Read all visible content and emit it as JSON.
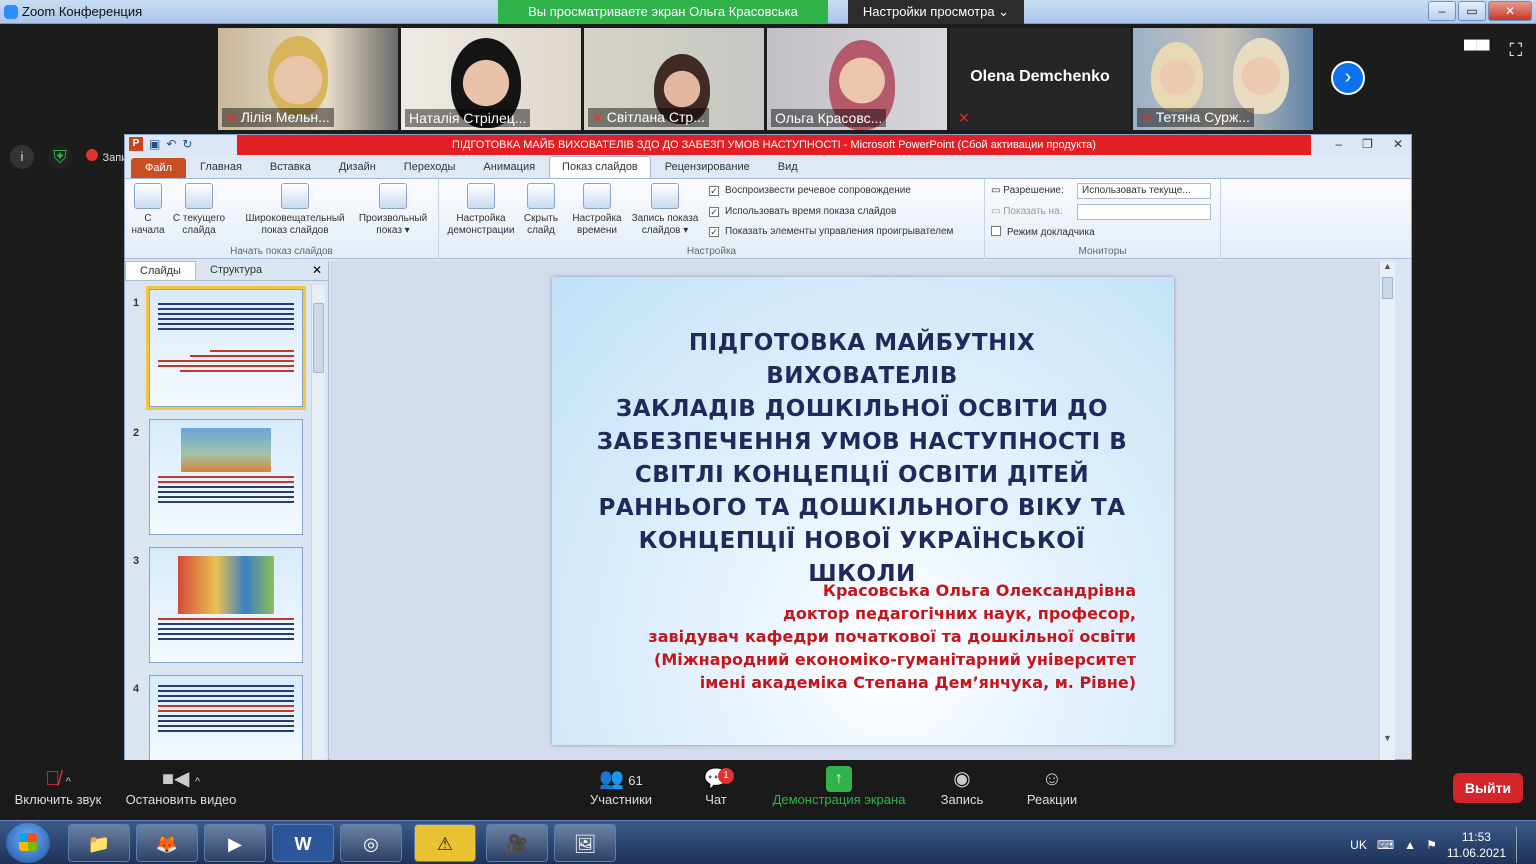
{
  "zoom": {
    "window_title": "Zoom Конференция",
    "share_banner": "Вы просматриваете экран Ольга Красовська",
    "view_options": "Настройки просмотра ⌄",
    "recording_label": "Запись",
    "participants": [
      {
        "name": "Лілія Мельн...",
        "muted": true
      },
      {
        "name": "Наталія Стрілец...",
        "muted": false
      },
      {
        "name": "Світлана Стр...",
        "muted": true
      },
      {
        "name": "Ольга Красовс...",
        "muted": false
      },
      {
        "name": "Olena Demchenko",
        "muted": true,
        "video_off": true
      },
      {
        "name": "Тетяна Сурж...",
        "muted": true
      }
    ],
    "toolbar": {
      "unmute": "Включить звук",
      "stop_video": "Остановить видео",
      "participants": "Участники",
      "participants_count": "61",
      "chat": "Чат",
      "chat_badge": "1",
      "share_screen": "Демонстрация экрана",
      "record": "Запись",
      "reactions": "Реакции",
      "leave": "Выйти"
    }
  },
  "ppt": {
    "title": "ПІДГОТОВКА МАЙБ ВИХОВАТЕЛІВ ЗДО ДО ЗАБЕЗП УМОВ НАСТУПНОСТІ  -  Microsoft PowerPoint (Сбой активации продукта)",
    "tabs": [
      "Файл",
      "Главная",
      "Вставка",
      "Дизайн",
      "Переходы",
      "Анимация",
      "Показ слайдов",
      "Рецензирование",
      "Вид"
    ],
    "ribbon": {
      "start_group": {
        "label": "Начать показ слайдов",
        "buttons": [
          "С начала",
          "С текущего слайда",
          "Широковещательный показ слайдов",
          "Произвольный показ ▾"
        ]
      },
      "setup_group": {
        "label": "Настройка",
        "buttons": [
          "Настройка демонстрации",
          "Скрыть слайд",
          "Настройка времени",
          "Запись показа слайдов ▾"
        ],
        "checks": [
          "Воспроизвести речевое сопровождение",
          "Использовать время показа слайдов",
          "Показать элементы управления проигрывателем"
        ]
      },
      "monitors_group": {
        "label": "Мониторы",
        "resolution_label": "Разрешение:",
        "resolution_value": "Использовать текуще...",
        "show_on_label": "Показать на:",
        "presenter_view": "Режим докладчика"
      }
    },
    "panel_tabs": [
      "Слайды",
      "Структура"
    ],
    "thumb_numbers": [
      "1",
      "2",
      "3",
      "4"
    ],
    "slide": {
      "title_lines": [
        "ПІДГОТОВКА МАЙБУТНІХ ВИХОВАТЕЛІВ",
        "ЗАКЛАДІВ ДОШКІЛЬНОЇ ОСВІТИ ДО",
        "ЗАБЕЗПЕЧЕННЯ УМОВ НАСТУПНОСТІ В",
        "СВІТЛІ КОНЦЕПЦІЇ ОСВІТИ ДІТЕЙ",
        "РАННЬОГО ТА ДОШКІЛЬНОГО ВІКУ ТА",
        "КОНЦЕПЦІЇ НОВОЇ УКРАЇНСЬКОЇ ШКОЛИ"
      ],
      "author_lines": [
        "Красовська Ольга Олександрівна",
        "доктор педагогічних наук, професор,",
        "завідувач кафедри початкової та дошкільної освіти",
        "(Міжнародний економіко-гуманітарний університет",
        "імені академіка Степана Дем’янчука, м. Рівне)"
      ]
    }
  },
  "taskbar": {
    "lang": "UK",
    "time": "11:53",
    "date": "11.06.2021"
  }
}
